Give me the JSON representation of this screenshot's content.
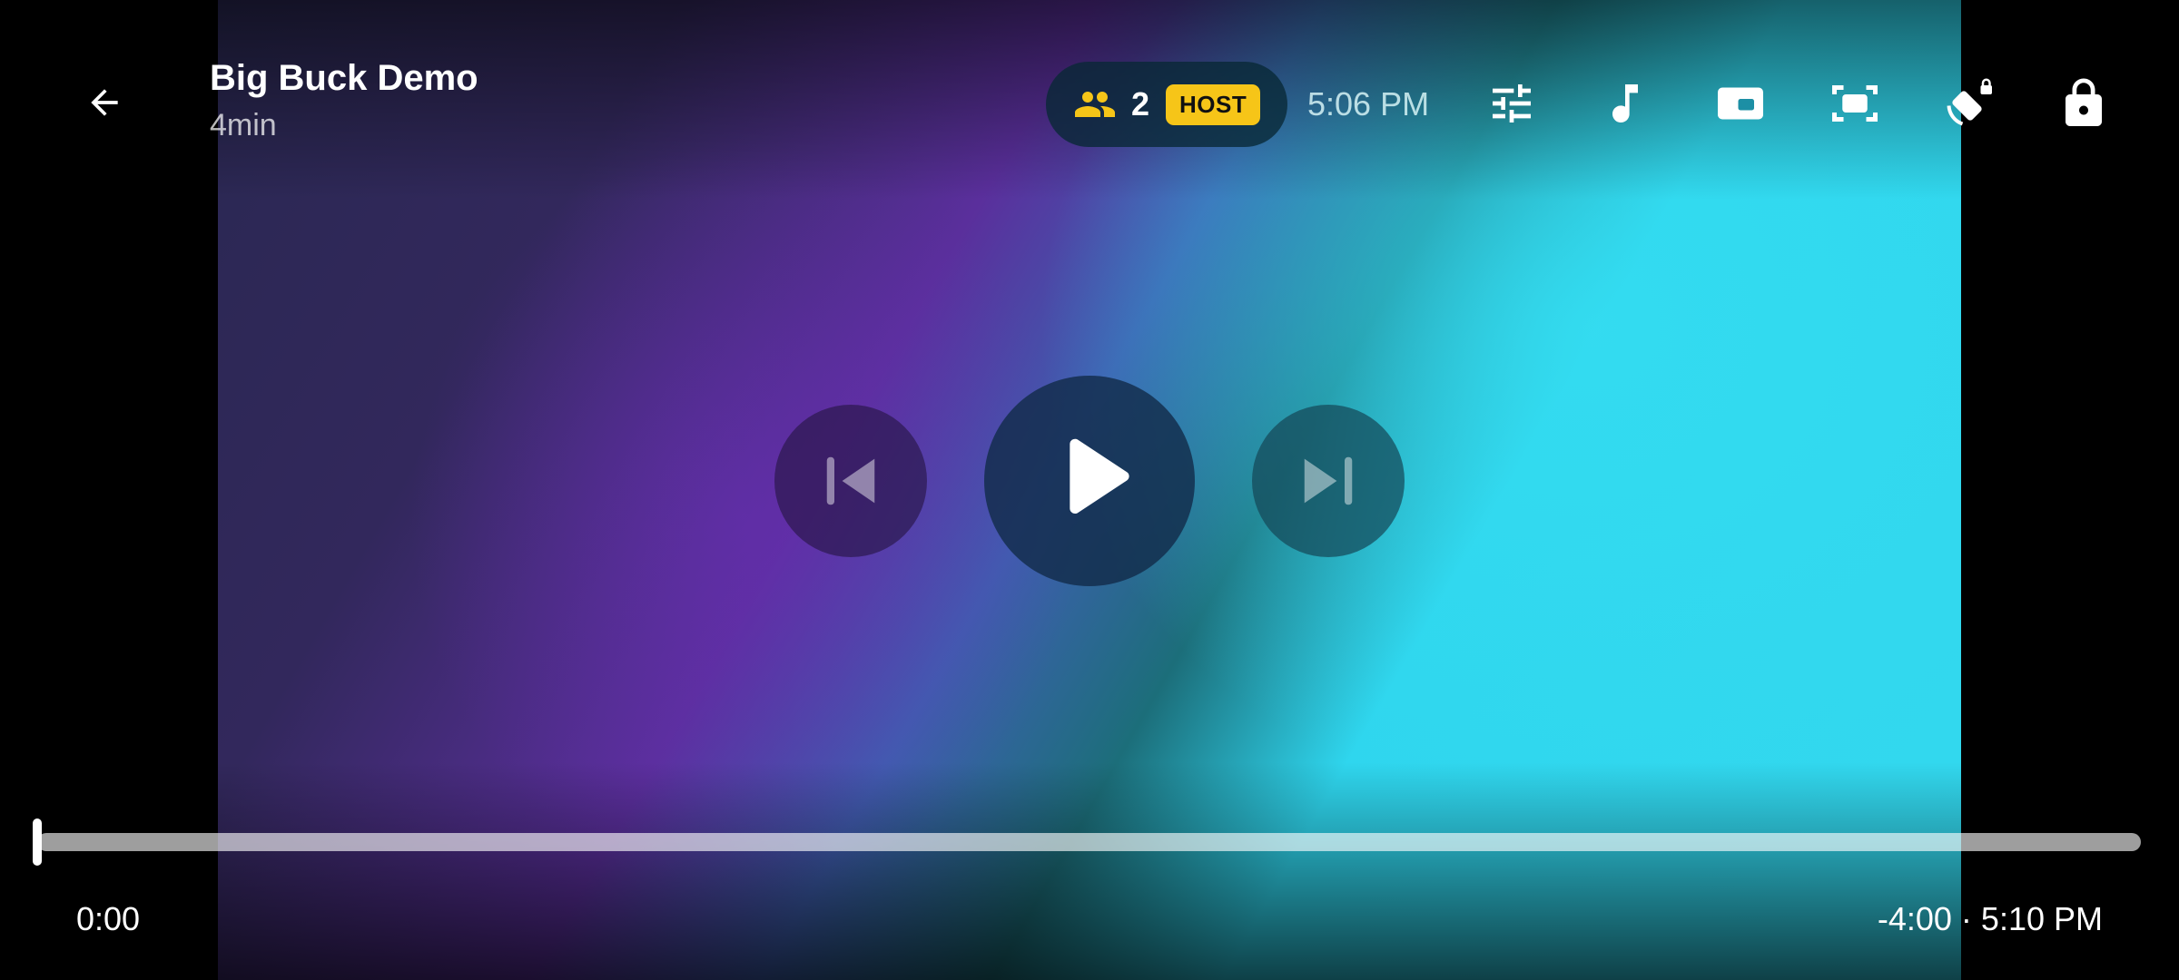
{
  "video": {
    "title": "Big Buck Demo",
    "duration_label": "4min"
  },
  "party": {
    "members_icon": "group-icon",
    "member_count": "2",
    "role_badge": "HOST"
  },
  "clock": "5:06 PM",
  "toolbar": {
    "icons": [
      "sliders-icon",
      "music-note-icon",
      "picture-in-picture-icon",
      "aspect-ratio-icon",
      "screen-rotation-lock-icon",
      "lock-icon"
    ]
  },
  "controls": {
    "previous_icon": "skip-previous-icon",
    "play_icon": "play-icon",
    "next_icon": "skip-next-icon"
  },
  "playback": {
    "elapsed": "0:00",
    "remaining_and_end": "-4:00 · 5:10 PM",
    "progress": 0
  },
  "colors": {
    "host_badge": "#f6c518",
    "party_icon": "#f6c518"
  }
}
